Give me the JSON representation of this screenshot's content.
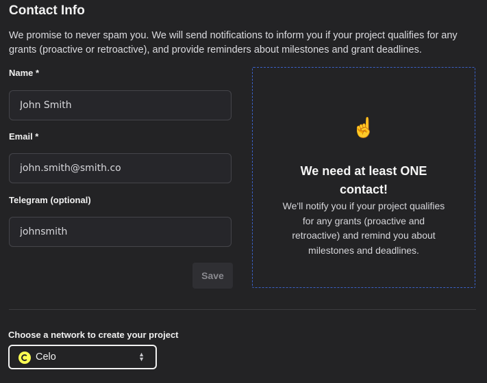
{
  "section": {
    "title": "Contact Info",
    "intro": "We promise to never spam you. We will send notifications to inform you if your project qualifies for any grants (proactive or retroactive), and provide reminders about milestones and grant deadlines."
  },
  "form": {
    "name_label": "Name *",
    "name_value": "John Smith",
    "email_label": "Email *",
    "email_value": "john.smith@smith.co",
    "telegram_label": "Telegram (optional)",
    "telegram_value": "johnsmith",
    "save_label": "Save"
  },
  "notice": {
    "emoji": "☝️",
    "heading": "We need at least ONE contact!",
    "body": "We'll notify you if your project qualifies for any grants (proactive and retroactive) and remind you about milestones and deadlines."
  },
  "network": {
    "label": "Choose a network to create your project",
    "selected": "Celo",
    "icon": "celo-logo-icon",
    "accent": "#fcff52"
  },
  "colors": {
    "background": "#232325",
    "notice_border": "#3b62c9"
  }
}
